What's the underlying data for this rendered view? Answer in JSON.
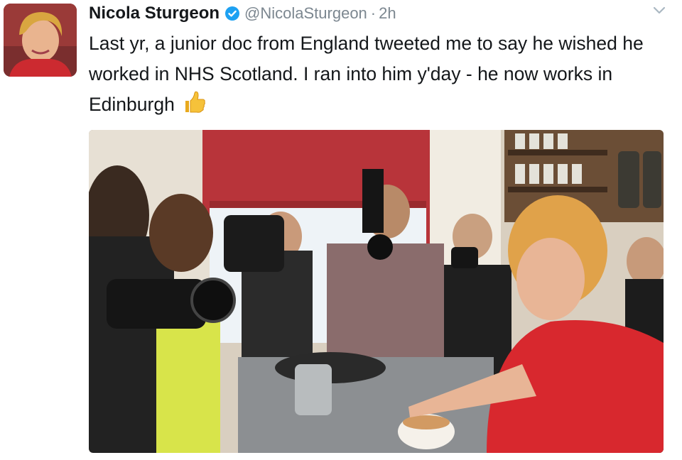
{
  "tweet": {
    "author": {
      "display_name": "Nicola Sturgeon",
      "verified": true,
      "handle": "@NicolaSturgeon",
      "avatar_icon": "profile-photo"
    },
    "separator": "·",
    "timestamp": "2h",
    "text": "Last yr, a junior doc from England tweeted me to say he wished he worked in NHS Scotland. I ran into him y'day - he now works in Edinburgh",
    "emoji": "👍",
    "emoji_name": "thumbs-up",
    "menu_icon": "chevron-down-icon"
  },
  "colors": {
    "text": "#14171a",
    "muted": "#7c8790",
    "verified_badge": "#1da1f2",
    "chevron": "#aab8c2",
    "background": "#ffffff"
  }
}
